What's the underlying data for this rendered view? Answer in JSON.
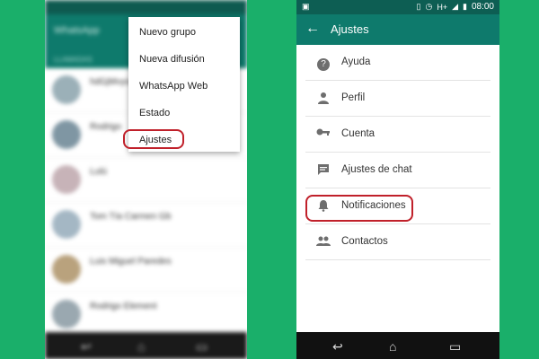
{
  "left_phone": {
    "app_title": "WhatsApp",
    "tabs_label": "LLAMADAS",
    "overflow_menu": {
      "items": [
        "Nuevo grupo",
        "Nueva difusión",
        "WhatsApp Web",
        "Estado",
        "Ajustes"
      ],
      "highlighted": "Ajustes"
    },
    "chats": [
      {
        "name": "hdGjMvyoJ",
        "msg": "",
        "time": ""
      },
      {
        "name": "Rodrigo",
        "msg": "",
        "time": ""
      },
      {
        "name": "Lulú",
        "msg": "",
        "time": ""
      },
      {
        "name": "Tom Tía Carmen Gb",
        "msg": "",
        "time": ""
      },
      {
        "name": "Luis Miguel Paredes",
        "msg": "",
        "time": ""
      },
      {
        "name": "Rodrigo Element",
        "msg": "",
        "time": ""
      }
    ]
  },
  "right_phone": {
    "status_time": "08:00",
    "status_network": "H+",
    "title": "Ajustes",
    "settings": [
      {
        "label": "Ayuda",
        "icon": "help-icon"
      },
      {
        "label": "Perfil",
        "icon": "person-icon"
      },
      {
        "label": "Cuenta",
        "icon": "key-icon"
      },
      {
        "label": "Ajustes de chat",
        "icon": "chat-icon"
      },
      {
        "label": "Notificaciones",
        "icon": "bell-icon"
      },
      {
        "label": "Contactos",
        "icon": "contacts-icon"
      }
    ],
    "highlighted": "Notificaciones"
  },
  "colors": {
    "background": "#1aaf6a",
    "appbar": "#0e7a6c",
    "statusbar": "#0d5e53",
    "highlight": "#c0202a"
  }
}
